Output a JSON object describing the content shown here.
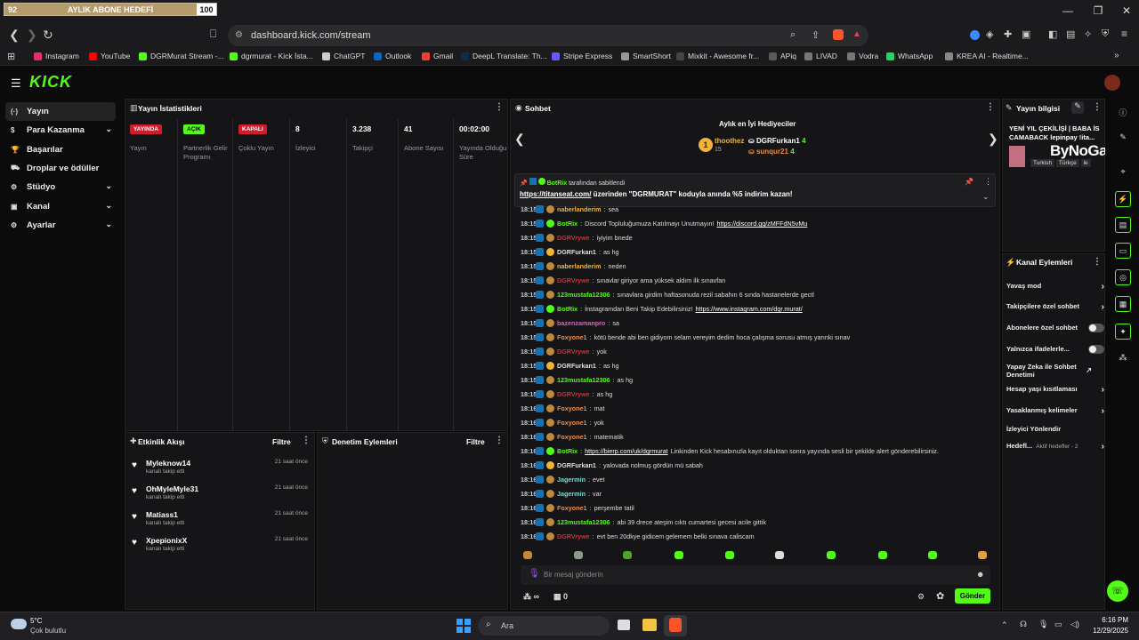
{
  "goal": {
    "left": "92",
    "label": "AYLIK ABONE HEDEFİ",
    "right": "100",
    "progress": 0.92
  },
  "window": {
    "minimize": "—",
    "restore": "❐",
    "close": "✕"
  },
  "address": {
    "url": "dashboard.kick.com/stream"
  },
  "bookmarks": [
    {
      "label": "Instagram",
      "color": "#e1306c"
    },
    {
      "label": "YouTube",
      "color": "#ff0000"
    },
    {
      "label": "DGRMurat Stream -...",
      "color": "#53fc18"
    },
    {
      "label": "dgrmurat - Kick İsta...",
      "color": "#53fc18"
    },
    {
      "label": "ChatGPT",
      "color": "#cccccc"
    },
    {
      "label": "Outlook",
      "color": "#0a66c2"
    },
    {
      "label": "Gmail",
      "color": "#ea4335"
    },
    {
      "label": "DeepL Translate: Th...",
      "color": "#0f2b46"
    },
    {
      "label": "Stripe Express",
      "color": "#635bff"
    },
    {
      "label": "SmartShort",
      "color": "#999999"
    },
    {
      "label": "Mixkit - Awesome fr...",
      "color": "#444444"
    },
    {
      "label": "APiq",
      "color": "#5a5a5a"
    },
    {
      "label": "LIVAD",
      "color": "#777777"
    },
    {
      "label": "Vodra",
      "color": "#777777"
    },
    {
      "label": "WhatsApp",
      "color": "#25d366"
    },
    {
      "label": "KREA AI - Realtime...",
      "color": "#888888"
    }
  ],
  "brand": {
    "logo": "KICK"
  },
  "nav": [
    {
      "label": "Yayın",
      "icon": "stream-icon",
      "chev": false,
      "active": true
    },
    {
      "label": "Para Kazanma",
      "icon": "money-icon",
      "chev": true
    },
    {
      "label": "Başarılar",
      "icon": "trophy-icon",
      "chev": false
    },
    {
      "label": "Droplar ve ödüller",
      "icon": "gift-icon",
      "chev": false
    },
    {
      "label": "Stüdyo",
      "icon": "studio-icon",
      "chev": true
    },
    {
      "label": "Kanal",
      "icon": "channel-icon",
      "chev": true
    },
    {
      "label": "Ayarlar",
      "icon": "gear-icon",
      "chev": true
    }
  ],
  "stats": {
    "title": "Yayın İstatistikleri",
    "items": [
      {
        "badge": "YAYINDA",
        "badge_color": "#d31b2c",
        "label": "Yayın"
      },
      {
        "badge": "AÇIK",
        "badge_color": "#53fc18",
        "label": "Partnerlik Gelir Programı"
      },
      {
        "badge": "KAPALI",
        "badge_color": "#d31b2c",
        "label": "Çoklu Yayın"
      },
      {
        "value": "8",
        "label": "İzleyici"
      },
      {
        "value": "3.238",
        "label": "Takipçi"
      },
      {
        "value": "41",
        "label": "Abone Sayısı"
      },
      {
        "value": "00:02:00",
        "label": "Yayında Olduğu Süre"
      }
    ]
  },
  "activity": {
    "title": "Etkinlik Akışı",
    "filter": "Filtre",
    "items": [
      {
        "name": "Myleknow14",
        "sub": "kanalı takip etti",
        "time": "21 saat önce"
      },
      {
        "name": "OhMyleMyle31",
        "sub": "kanalı takip etti",
        "time": "21 saat önce"
      },
      {
        "name": "Matiass1",
        "sub": "kanalı takip etti",
        "time": "21 saat önce"
      },
      {
        "name": "XpepionixX",
        "sub": "kanalı takip etti",
        "time": "21 saat önce"
      }
    ]
  },
  "moderation": {
    "title": "Denetim Eylemleri",
    "filter": "Filtre"
  },
  "chat": {
    "title": "Sohbet",
    "gifters_title": "Aylık en İyi Hediyeciler",
    "gifters": [
      {
        "rank": "1",
        "name": "thoothez",
        "count": "15"
      },
      {
        "name": "DGRFurkan1",
        "count": "4"
      },
      {
        "name": "sunqur21",
        "count": "4"
      }
    ],
    "pinned_by": "BotRix",
    "pinned_suffix": "tarafından sabitlendi",
    "pinned_link": "https://titanseat.com/",
    "pinned_text": " üzerinden \"DGRMURAT\" koduyla anında %5 indirim kazan!",
    "messages": [
      {
        "t": "18:15",
        "u": "naberlanderim",
        "c": "#f0b43a",
        "m": "sea"
      },
      {
        "t": "18:15",
        "u": "BotRix",
        "c": "#53fc18",
        "m": "Discord Topluluğumuza Katılmayı Unutmayın! ",
        "link": "https://discord.gg/zMFFdN5vMu"
      },
      {
        "t": "18:15",
        "u": "DGRVrywe",
        "c": "#d62a35",
        "m": "iyiyim bnede"
      },
      {
        "t": "18:15",
        "u": "DGRFurkan1",
        "c": "#e0e0e0",
        "m": "as hg"
      },
      {
        "t": "18:15",
        "u": "naberlanderim",
        "c": "#f0b43a",
        "m": "neden"
      },
      {
        "t": "18:15",
        "u": "DGRVrywe",
        "c": "#d62a35",
        "m": "sınavlar giriyor ama yüksek aldım ilk sınavfan"
      },
      {
        "t": "18:15",
        "u": "123mustafa12306",
        "c": "#53fc18",
        "m": "sınavlara girdim haftasonuda rezil sabahın 6 sında hastanelerde gectl"
      },
      {
        "t": "18:15",
        "u": "BotRix",
        "c": "#53fc18",
        "m": "İnstagramdan Beni Takip Edebilirsiniz! ",
        "link": "https://www.instagram.com/dgr.murat/"
      },
      {
        "t": "18:15",
        "u": "bazenzamanpro",
        "c": "#e060c0",
        "m": "sa"
      },
      {
        "t": "18:15",
        "u": "Foxyone1",
        "c": "#f08a3a",
        "m": "kötü bende abi ben gidiyom selam vereyim dedim hoca çalışma sorusu atmış yarınki sınav"
      },
      {
        "t": "18:15",
        "u": "DGRVrywe",
        "c": "#d62a35",
        "m": "yok"
      },
      {
        "t": "18:15",
        "u": "DGRFurkan1",
        "c": "#e0e0e0",
        "m": "as hg"
      },
      {
        "t": "18:15",
        "u": "123mustafa12306",
        "c": "#53fc18",
        "m": "as hg"
      },
      {
        "t": "18:15",
        "u": "DGRVrywe",
        "c": "#d62a35",
        "m": "as hg"
      },
      {
        "t": "18:16",
        "u": "Foxyone1",
        "c": "#f08a3a",
        "m": "mat"
      },
      {
        "t": "18:16",
        "u": "Foxyone1",
        "c": "#f08a3a",
        "m": "yok"
      },
      {
        "t": "18:16",
        "u": "Foxyone1",
        "c": "#f08a3a",
        "m": "matematik"
      },
      {
        "t": "18:16",
        "u": "BotRix",
        "c": "#53fc18",
        "m": " Linkinden Kick hesabınızla kayıt olduktan sonra yayında sesli bir şekilde alert gönderebilirsiniz.",
        "link": "https://bierp.com/uk/dgrmurat",
        "linkfirst": true
      },
      {
        "t": "18:16",
        "u": "DGRFurkan1",
        "c": "#e0e0e0",
        "m": "yalovada nolmuş gördün mü sabah"
      },
      {
        "t": "18:16",
        "u": "Jagermin",
        "c": "#7fd8d8",
        "m": "evet"
      },
      {
        "t": "18:16",
        "u": "Jagermin",
        "c": "#7fd8d8",
        "m": "var"
      },
      {
        "t": "18:16",
        "u": "Foxyone1",
        "c": "#f08a3a",
        "m": "perşembe tatil"
      },
      {
        "t": "18:16",
        "u": "123mustafa12306",
        "c": "#53fc18",
        "m": "abi 39 drece ateşim cıktı cumartesi gecesi acile gittik"
      },
      {
        "t": "18:16",
        "u": "DGRVrywe",
        "c": "#d62a35",
        "m": "evt ben 20dkye gidicem gelemem belki sınava caliscam"
      }
    ],
    "input_placeholder": "Bir mesaj gönderin",
    "bottom_left": "∞",
    "bottom_count": "0",
    "send": "Gönder"
  },
  "info": {
    "title": "Yayın bilgisi",
    "stream_title": "YENİ YIL ÇEKİLİŞİ | BABA İS CAMABACK lepinpay !ita...",
    "tags": [
      "Turkish",
      "Türkçe",
      "le"
    ],
    "overlay": "ByNoGame"
  },
  "actions": {
    "title": "Kanal Eylemleri",
    "items": [
      {
        "label": "Yavaş mod",
        "kind": "chev"
      },
      {
        "label": "Takipçilere özel sohbet",
        "kind": "chev"
      },
      {
        "label": "Abonelere özel sohbet",
        "kind": "toggle"
      },
      {
        "label": "Yalnızca ifadelerle...",
        "kind": "toggle"
      },
      {
        "label": "Yapay Zeka ile Sohbet Denetimi",
        "kind": "ext"
      },
      {
        "label": "Hesap yaşı kısıtlaması",
        "kind": "chev"
      },
      {
        "label": "Yasaklanmış kelimeler",
        "kind": "chev"
      },
      {
        "label": "İzleyici Yönlendir",
        "kind": "none"
      },
      {
        "label": "Hedefl...",
        "kind": "chev",
        "extra": "Aktif hedefler - 2"
      }
    ]
  },
  "taskbar": {
    "temp": "5°C",
    "weather": "Çok bulutlu",
    "search": "Ara",
    "time": "6:16 PM",
    "date": "12/29/2025"
  }
}
